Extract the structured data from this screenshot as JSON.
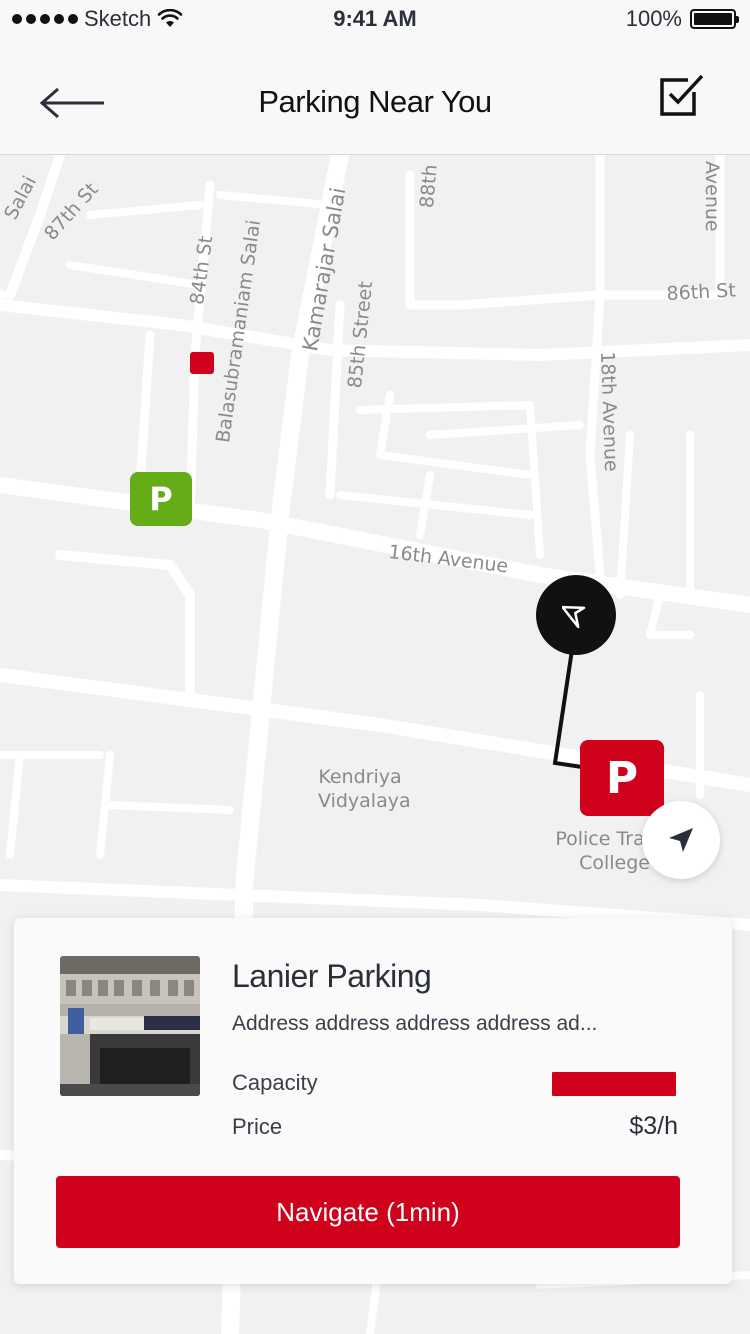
{
  "status_bar": {
    "carrier": "Sketch",
    "time": "9:41 AM",
    "battery": "100%"
  },
  "nav": {
    "title": "Parking Near You",
    "back_icon": "arrow-left-icon",
    "action_icon": "checkbox-checked-icon"
  },
  "map": {
    "streets": [
      "Salai",
      "87th St",
      "84th St",
      "Balasubramaniam Salai",
      "Kamarajar Salai",
      "88th",
      "Avenue",
      "86th St",
      "85th Street",
      "18th Avenue",
      "16th Avenue"
    ],
    "places": [
      "Kendriya\nVidyalaya",
      "Police Trai\nCollege"
    ],
    "pins": [
      {
        "label": "P",
        "color": "#64ad18"
      },
      {
        "label": "P",
        "color": "#d0011b"
      }
    ]
  },
  "card": {
    "title": "Lanier Parking",
    "address": "Address address address address ad...",
    "capacity_label": "Capacity",
    "price_label": "Price",
    "price_value": "$3/h",
    "capacity_color": "#d0011b",
    "button_label": "Navigate (1min)"
  },
  "colors": {
    "accent": "#d0011b",
    "green": "#64ad18"
  }
}
